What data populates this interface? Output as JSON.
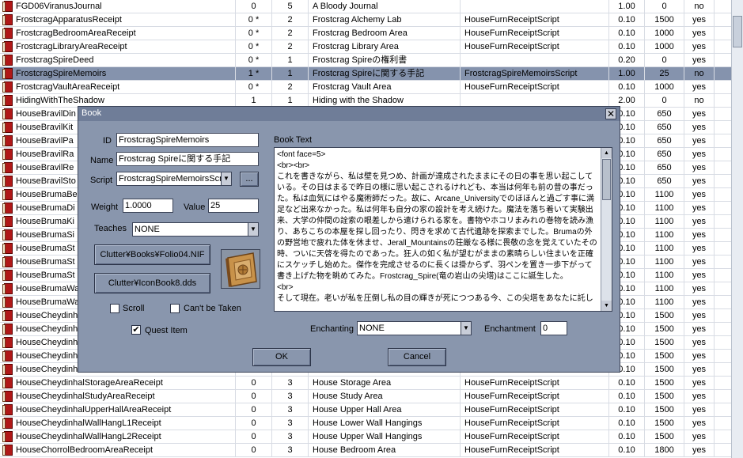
{
  "list": {
    "rows": [
      {
        "id": "FGD06ViranusJournal",
        "c1": "0",
        "c2": "5",
        "name": "A Bloody Journal",
        "script": "",
        "weight": "1.00",
        "value": "0",
        "flag": "no"
      },
      {
        "id": "FrostcragApparatusReceipt",
        "c1": "0 *",
        "c2": "2",
        "name": "Frostcrag Alchemy Lab",
        "script": "HouseFurnReceiptScript",
        "weight": "0.10",
        "value": "1500",
        "flag": "yes"
      },
      {
        "id": "FrostcragBedroomAreaReceipt",
        "c1": "0 *",
        "c2": "2",
        "name": "Frostcrag Bedroom Area",
        "script": "HouseFurnReceiptScript",
        "weight": "0.10",
        "value": "1000",
        "flag": "yes"
      },
      {
        "id": "FrostcragLibraryAreaReceipt",
        "c1": "0 *",
        "c2": "2",
        "name": "Frostcrag Library Area",
        "script": "HouseFurnReceiptScript",
        "weight": "0.10",
        "value": "1000",
        "flag": "yes"
      },
      {
        "id": "FrostcragSpireDeed",
        "c1": "0 *",
        "c2": "1",
        "name": "Frostcrag Spireの権利書",
        "script": "",
        "weight": "0.20",
        "value": "0",
        "flag": "yes"
      },
      {
        "id": "FrostcragSpireMemoirs",
        "c1": "1 *",
        "c2": "1",
        "name": "Frostcrag Spireに関する手記",
        "script": "FrostcragSpireMemoirsScript",
        "weight": "1.00",
        "value": "25",
        "flag": "no",
        "selected": true
      },
      {
        "id": "FrostcragVaultAreaReceipt",
        "c1": "0 *",
        "c2": "2",
        "name": "Frostcrag Vault Area",
        "script": "HouseFurnReceiptScript",
        "weight": "0.10",
        "value": "1000",
        "flag": "yes"
      },
      {
        "id": "HidingWithTheShadow",
        "c1": "1",
        "c2": "1",
        "name": "Hiding with the Shadow",
        "script": "",
        "weight": "2.00",
        "value": "0",
        "flag": "no"
      },
      {
        "id": "HouseBravilDin",
        "c1": "",
        "c2": "",
        "name": "",
        "script": "",
        "weight": "0.10",
        "value": "650",
        "flag": "yes"
      },
      {
        "id": "HouseBravilKit",
        "c1": "",
        "c2": "",
        "name": "",
        "script": "",
        "weight": "0.10",
        "value": "650",
        "flag": "yes"
      },
      {
        "id": "HouseBravilPa",
        "c1": "",
        "c2": "",
        "name": "",
        "script": "",
        "weight": "0.10",
        "value": "650",
        "flag": "yes"
      },
      {
        "id": "HouseBravilRa",
        "c1": "",
        "c2": "",
        "name": "",
        "script": "",
        "weight": "0.10",
        "value": "650",
        "flag": "yes"
      },
      {
        "id": "HouseBravilRe",
        "c1": "",
        "c2": "",
        "name": "",
        "script": "",
        "weight": "0.10",
        "value": "650",
        "flag": "yes"
      },
      {
        "id": "HouseBravilSto",
        "c1": "",
        "c2": "",
        "name": "",
        "script": "",
        "weight": "0.10",
        "value": "650",
        "flag": "yes"
      },
      {
        "id": "HouseBrumaBe",
        "c1": "",
        "c2": "",
        "name": "",
        "script": "",
        "weight": "0.10",
        "value": "1100",
        "flag": "yes"
      },
      {
        "id": "HouseBrumaDi",
        "c1": "",
        "c2": "",
        "name": "",
        "script": "",
        "weight": "0.10",
        "value": "1100",
        "flag": "yes"
      },
      {
        "id": "HouseBrumaKi",
        "c1": "",
        "c2": "",
        "name": "",
        "script": "",
        "weight": "0.10",
        "value": "1100",
        "flag": "yes"
      },
      {
        "id": "HouseBrumaSi",
        "c1": "",
        "c2": "",
        "name": "",
        "script": "",
        "weight": "0.10",
        "value": "1100",
        "flag": "yes"
      },
      {
        "id": "HouseBrumaSt",
        "c1": "",
        "c2": "",
        "name": "",
        "script": "",
        "weight": "0.10",
        "value": "1100",
        "flag": "yes"
      },
      {
        "id": "HouseBrumaSt",
        "c1": "",
        "c2": "",
        "name": "",
        "script": "",
        "weight": "0.10",
        "value": "1100",
        "flag": "yes"
      },
      {
        "id": "HouseBrumaSt",
        "c1": "",
        "c2": "",
        "name": "",
        "script": "",
        "weight": "0.10",
        "value": "1100",
        "flag": "yes"
      },
      {
        "id": "HouseBrumaWa",
        "c1": "",
        "c2": "",
        "name": "",
        "script": "",
        "weight": "0.10",
        "value": "1100",
        "flag": "yes"
      },
      {
        "id": "HouseBrumaWa",
        "c1": "",
        "c2": "",
        "name": "",
        "script": "",
        "weight": "0.10",
        "value": "1100",
        "flag": "yes"
      },
      {
        "id": "HouseCheydinh",
        "c1": "",
        "c2": "",
        "name": "",
        "script": "",
        "weight": "0.10",
        "value": "1500",
        "flag": "yes"
      },
      {
        "id": "HouseCheydinh",
        "c1": "",
        "c2": "",
        "name": "",
        "script": "",
        "weight": "0.10",
        "value": "1500",
        "flag": "yes"
      },
      {
        "id": "HouseCheydinh",
        "c1": "",
        "c2": "",
        "name": "",
        "script": "",
        "weight": "0.10",
        "value": "1500",
        "flag": "yes"
      },
      {
        "id": "HouseCheydinh",
        "c1": "",
        "c2": "",
        "name": "",
        "script": "",
        "weight": "0.10",
        "value": "1500",
        "flag": "yes"
      },
      {
        "id": "HouseCheydinh",
        "c1": "",
        "c2": "",
        "name": "",
        "script": "",
        "weight": "0.10",
        "value": "1500",
        "flag": "yes"
      },
      {
        "id": "HouseCheydinhalStorageAreaReceipt",
        "c1": "0",
        "c2": "3",
        "name": "House Storage Area",
        "script": "HouseFurnReceiptScript",
        "weight": "0.10",
        "value": "1500",
        "flag": "yes"
      },
      {
        "id": "HouseCheydinhalStudyAreaReceipt",
        "c1": "0",
        "c2": "3",
        "name": "House Study Area",
        "script": "HouseFurnReceiptScript",
        "weight": "0.10",
        "value": "1500",
        "flag": "yes"
      },
      {
        "id": "HouseCheydinhalUpperHallAreaReceipt",
        "c1": "0",
        "c2": "3",
        "name": "House Upper Hall Area",
        "script": "HouseFurnReceiptScript",
        "weight": "0.10",
        "value": "1500",
        "flag": "yes"
      },
      {
        "id": "HouseCheydinhalWallHangL1Receipt",
        "c1": "0",
        "c2": "3",
        "name": "House Lower Wall Hangings",
        "script": "HouseFurnReceiptScript",
        "weight": "0.10",
        "value": "1500",
        "flag": "yes"
      },
      {
        "id": "HouseCheydinhalWallHangL2Receipt",
        "c1": "0",
        "c2": "3",
        "name": "House Upper Wall Hangings",
        "script": "HouseFurnReceiptScript",
        "weight": "0.10",
        "value": "1500",
        "flag": "yes"
      },
      {
        "id": "HouseChorrolBedroomAreaReceipt",
        "c1": "0",
        "c2": "3",
        "name": "House Bedroom Area",
        "script": "HouseFurnReceiptScript",
        "weight": "0.10",
        "value": "1800",
        "flag": "yes"
      }
    ]
  },
  "dialog": {
    "title": "Book",
    "close_glyph": "✕",
    "id_label": "ID",
    "id_value": "FrostcragSpireMemoirs",
    "name_label": "Name",
    "name_value": "Frostcrag Spireに関する手記",
    "script_label": "Script",
    "script_value": "FrostcragSpireMemoirsScrip",
    "script_browse": "...",
    "weight_label": "Weight",
    "weight_value": "1.0000",
    "value_label": "Value",
    "value_value": "25",
    "teaches_label": "Teaches",
    "teaches_value": "NONE",
    "model_button": "Clutter¥Books¥Folio04.NIF",
    "icon_button": "Clutter¥IconBook8.dds",
    "scroll_label": "Scroll",
    "scroll_checked": false,
    "cant_be_taken_label": "Can't be Taken",
    "cant_be_taken_checked": false,
    "quest_item_label": "Quest Item",
    "quest_item_checked": true,
    "book_text_label": "Book Text",
    "book_text": "<font face=5>\n<br><br>\nこれを書きながら、私は壁を見つめ、計画が達成されたままにその日の事を思い起こしている。その日はまるで昨日の様に思い起こされるけれども、本当は何年も前の昔の事だった。私は血気にはやる魔術師だった。故に、Arcane_Universityでのほほんと過ごす事に満足など出来なかった。私は何年も自分の家の設計を考え続けた。魔法を落ち着いて実験出来、大学の仲間の詮索の眼差しから遣けられる家を。書物やホコリまみれの巻物を読み漁り、あちこちの本屋を探し回ったり、閃きを求めて古代遺跡を探索までした。Brumaの外の野営地で疲れた体を休ませ、Jerall_Mountainsの荘厳なる様に畏敬の念を覚えていたその時、ついに天啓を得たのであった。狂人の如く私が望むがままの素晴らしい住まいを正確にスケッチし始めた。傑作を完成させるのに長くは掛からず、羽ペンを置き一歩下がって書き上げた物を眺めてみた。Frostcrag_Spire(竜の岩山の尖塔)はここに誕生した。\n<br>\nそして現在。老いが私を圧倒し私の目の輝きが死につつある今、この尖塔をあなたに託し",
    "enchanting_label": "Enchanting",
    "enchanting_value": "NONE",
    "enchantment_label": "Enchantment",
    "enchantment_value": "0",
    "ok_label": "OK",
    "cancel_label": "Cancel"
  },
  "colors": {
    "dialog_bg": "#8996ad",
    "titlebar": "#6f7d98",
    "selected_row": "#8593ad",
    "book_cover": "#b01818"
  }
}
